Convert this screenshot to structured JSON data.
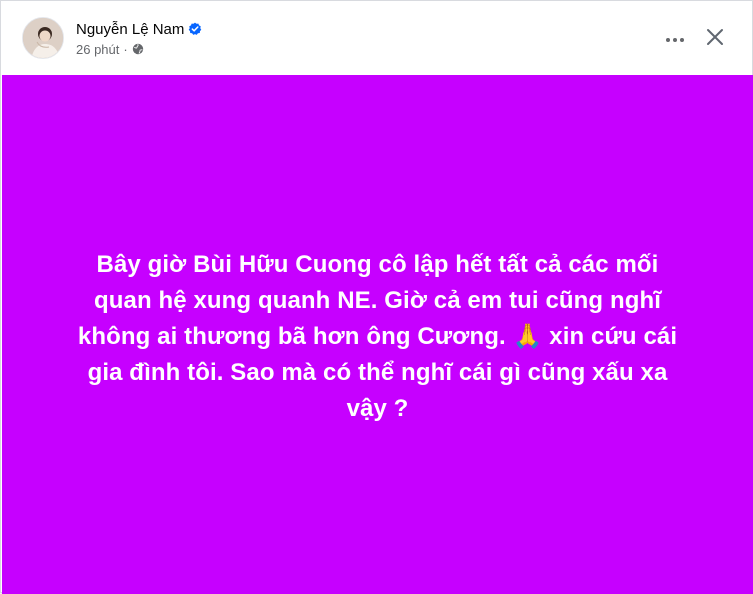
{
  "post": {
    "author_name": "Nguyễn Lệ Nam",
    "time": "26 phút",
    "separator": "·",
    "privacy_icon": "globe-icon",
    "verified_icon": "verified-badge-icon",
    "verified_color": "#0866ff",
    "background_color": "#c600ff",
    "text_color": "#ffffff",
    "text": "Bây giờ Bùi Hữu Cuong cô lập hết tất cả các mối quan hệ xung quanh NE. Giờ cả em tui cũng nghĩ không ai thương bã hơn ông Cương. 🙏 xin cứu cái gia đình tôi. Sao mà có thể nghĩ cái gì cũng xấu xa vậy ?"
  },
  "header_actions": {
    "more_icon": "more-horizontal-icon",
    "close_icon": "close-icon"
  }
}
